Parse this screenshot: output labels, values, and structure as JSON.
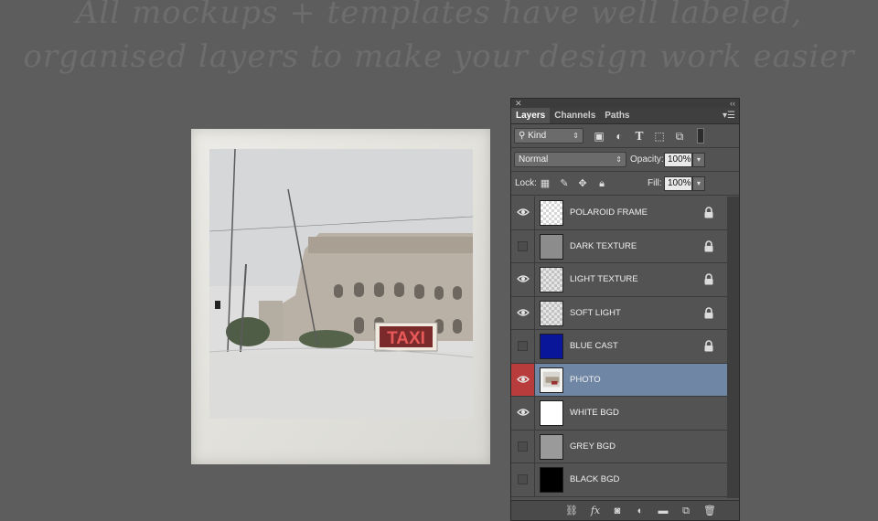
{
  "headline": {
    "line1": "All mockups + templates have well labeled,",
    "line2": "organised layers to make your design work easier"
  },
  "photo": {
    "sign_text": "TAXI"
  },
  "panel": {
    "tabs": [
      "Layers",
      "Channels",
      "Paths"
    ],
    "filter": {
      "kind_label": "Kind"
    },
    "blend_mode": "Normal",
    "opacity_label": "Opacity:",
    "opacity_value": "100%",
    "lock_label": "Lock:",
    "fill_label": "Fill:",
    "fill_value": "100%",
    "layers": [
      {
        "name": "POLAROID FRAME",
        "visible": true,
        "locked": true,
        "thumb": "checker"
      },
      {
        "name": "DARK TEXTURE",
        "visible": false,
        "locked": true,
        "thumb": "#8c8c8c"
      },
      {
        "name": "LIGHT TEXTURE",
        "visible": true,
        "locked": true,
        "thumb": "checker-light"
      },
      {
        "name": "SOFT LIGHT",
        "visible": true,
        "locked": true,
        "thumb": "checker-light"
      },
      {
        "name": "BLUE CAST",
        "visible": false,
        "locked": true,
        "thumb": "#0a169a"
      },
      {
        "name": "PHOTO",
        "visible": true,
        "locked": false,
        "selected": true,
        "thumb": "photo"
      },
      {
        "name": "WHITE BGD",
        "visible": true,
        "locked": false,
        "thumb": "#ffffff"
      },
      {
        "name": "GREY BGD",
        "visible": false,
        "locked": false,
        "thumb": "#9a9a9a"
      },
      {
        "name": "BLACK BGD",
        "visible": false,
        "locked": false,
        "thumb": "#000000"
      }
    ]
  },
  "colors": {
    "background": "#5d5d5d",
    "panel": "#535353",
    "selected_row": "#6f87a4",
    "eye_highlight": "#b83c3c"
  }
}
